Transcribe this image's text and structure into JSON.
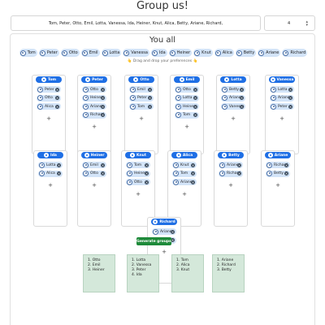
{
  "page": {
    "title": "Group us!"
  },
  "names_input": {
    "value": "Tom, Peter, Otto, Emil, Lotta, Vanessa, Ida, Heiner, Knut, Alica, Betty, Ariane, Richard,"
  },
  "group_count": {
    "value": "4",
    "spinner_icon": "up-down-icon"
  },
  "main": {
    "title": "You all",
    "hint": "👆 Drag and drop your preferences 👆"
  },
  "pool": [
    "Tom",
    "Peter",
    "Otto",
    "Emil",
    "Lotta",
    "Vanessa",
    "Ida",
    "Heiner",
    "Knut",
    "Alica",
    "Betty",
    "Ariane",
    "Richard"
  ],
  "cards": [
    {
      "name": "Tom",
      "prefs": [
        "Peter",
        "Otto",
        "Alica"
      ],
      "add": "+"
    },
    {
      "name": "Peter",
      "prefs": [
        "Otto",
        "Heiner",
        "Ariane",
        "Richard"
      ],
      "add": "+"
    },
    {
      "name": "Otto",
      "prefs": [
        "Emil",
        "Peter",
        "Tom"
      ],
      "add": "+"
    },
    {
      "name": "Emil",
      "prefs": [
        "Otto",
        "Lotta",
        "Heiner",
        "Tom"
      ],
      "add": "+"
    },
    {
      "name": "Lotta",
      "prefs": [
        "Betty",
        "Ariane",
        "Vanessa"
      ],
      "add": "+"
    },
    {
      "name": "Vanessa",
      "prefs": [
        "Lotta",
        "Ariane",
        "Peter"
      ],
      "add": "+"
    },
    {
      "name": "Ida",
      "prefs": [
        "Lotta",
        "Alica"
      ],
      "add": "+"
    },
    {
      "name": "Heiner",
      "prefs": [
        "Emil",
        "Otto"
      ],
      "add": "+"
    },
    {
      "name": "Knut",
      "prefs": [
        "Tom",
        "Heiner",
        "Otto"
      ],
      "add": "+"
    },
    {
      "name": "Alica",
      "prefs": [
        "Knut",
        "Tom",
        "Ariane"
      ],
      "add": "+"
    },
    {
      "name": "Betty",
      "prefs": [
        "Ariane",
        "Richard"
      ],
      "add": "+"
    },
    {
      "name": "Ariane",
      "prefs": [
        "Richard",
        "Betty"
      ],
      "add": "+"
    },
    {
      "name": "Richard",
      "prefs": [
        "Ariane",
        "Betty"
      ],
      "add": "+"
    }
  ],
  "generate_button": {
    "label": "Generate groups"
  },
  "groups": [
    [
      "1. Otto",
      "2. Emil",
      "3. Heiner"
    ],
    [
      "1. Lotta",
      "2. Vanessa",
      "3. Peter",
      "4. Ida"
    ],
    [
      "1. Tom",
      "2. Alica",
      "3. Knut"
    ],
    [
      "1. Ariane",
      "2. Richard",
      "3. Betty"
    ]
  ],
  "colors": {
    "accent": "#1f6fe5",
    "chip": "#d3e4f8",
    "generate": "#1e8a3a",
    "group_bg": "#d4e8da"
  }
}
